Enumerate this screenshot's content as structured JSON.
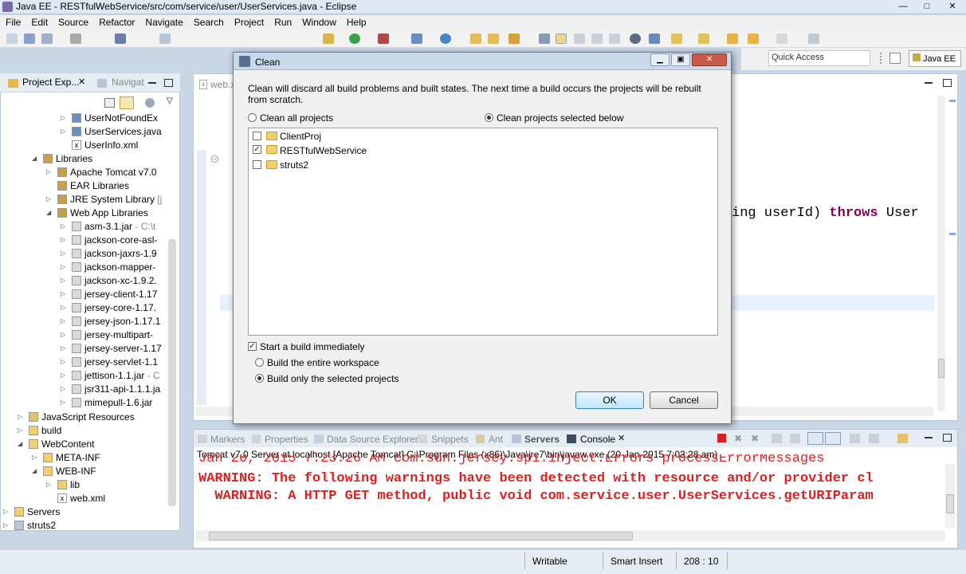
{
  "window": {
    "title": "Java EE - RESTfulWebService/src/com/service/user/UserServices.java - Eclipse",
    "buttons": [
      "—",
      "□",
      "✕"
    ]
  },
  "menu": [
    "File",
    "Edit",
    "Source",
    "Refactor",
    "Navigate",
    "Search",
    "Project",
    "Run",
    "Window",
    "Help"
  ],
  "toolbar": {
    "quick_access": "Quick Access",
    "perspective": "Java EE"
  },
  "left": {
    "tabs": [
      "Project Exp...",
      "Navigat"
    ],
    "tree": [
      {
        "label": "UserNotFoundEx",
        "extra": ""
      },
      {
        "label": "UserServices.java",
        "extra": ""
      },
      {
        "label": "UserInfo.xml",
        "extra": ""
      },
      {
        "label": "Libraries",
        "extra": ""
      },
      {
        "label": "Apache Tomcat v7.0",
        "extra": ""
      },
      {
        "label": "EAR Libraries",
        "extra": ""
      },
      {
        "label": "JRE System Library",
        "extra": " [j"
      },
      {
        "label": "Web App Libraries",
        "extra": ""
      },
      {
        "label": "asm-3.1.jar",
        "extra": " - C:\\t"
      },
      {
        "label": "jackson-core-asl-",
        "extra": ""
      },
      {
        "label": "jackson-jaxrs-1.9",
        "extra": ""
      },
      {
        "label": "jackson-mapper-",
        "extra": ""
      },
      {
        "label": "jackson-xc-1.9.2.",
        "extra": ""
      },
      {
        "label": "jersey-client-1.17",
        "extra": ""
      },
      {
        "label": "jersey-core-1.17.",
        "extra": ""
      },
      {
        "label": "jersey-json-1.17.1",
        "extra": ""
      },
      {
        "label": "jersey-multipart-",
        "extra": ""
      },
      {
        "label": "jersey-server-1.17",
        "extra": ""
      },
      {
        "label": "jersey-servlet-1.1",
        "extra": ""
      },
      {
        "label": "jettison-1.1.jar",
        "extra": " - C"
      },
      {
        "label": "jsr311-api-1.1.1.ja",
        "extra": ""
      },
      {
        "label": "mimepull-1.6.jar",
        "extra": ""
      },
      {
        "label": "JavaScript Resources",
        "extra": ""
      },
      {
        "label": "build",
        "extra": ""
      },
      {
        "label": "WebContent",
        "extra": ""
      },
      {
        "label": "META-INF",
        "extra": ""
      },
      {
        "label": "WEB-INF",
        "extra": ""
      },
      {
        "label": "lib",
        "extra": ""
      },
      {
        "label": "web.xml",
        "extra": ""
      },
      {
        "label": "Servers",
        "extra": ""
      },
      {
        "label": "struts2",
        "extra": ""
      }
    ]
  },
  "editor": {
    "tab": "web.x",
    "code_fragment_1": "ing userId) ",
    "code_keyword": "throws",
    "code_fragment_2": " User"
  },
  "bottom": {
    "tabs": [
      "Markers",
      "Properties",
      "Data Source Explorer",
      "Snippets",
      "Ant",
      "Servers",
      "Console"
    ],
    "console_header": "Tomcat v7.0 Server at localhost [Apache Tomcat] C:\\Program Files (x86)\\Java\\jre7\\bin\\javaw.exe (20-Jan-2015 7:03:28 am)",
    "lines": [
      "Jan 20, 2015 7:23:26 AM com.sun.jersey.spi.inject.Errors processErrorMessages",
      "WARNING: The following warnings have been detected with resource and/or provider cl",
      "  WARNING: A HTTP GET method, public void com.service.user.UserServices.getURIParam"
    ]
  },
  "status": {
    "writable": "Writable",
    "insert": "Smart Insert",
    "position": "208 : 10"
  },
  "dialog": {
    "title": "Clean",
    "description": "Clean will discard all build problems and built states.  The next time a build occurs the projects will be rebuilt from scratch.",
    "option_all": "Clean all projects",
    "option_selected": "Clean projects selected below",
    "projects": [
      {
        "name": "ClientProj",
        "checked": false
      },
      {
        "name": "RESTfulWebService",
        "checked": true
      },
      {
        "name": "struts2",
        "checked": false
      }
    ],
    "start_build": "Start a build immediately",
    "build_workspace": "Build the entire workspace",
    "build_selected": "Build only the selected projects",
    "ok": "OK",
    "cancel": "Cancel"
  }
}
